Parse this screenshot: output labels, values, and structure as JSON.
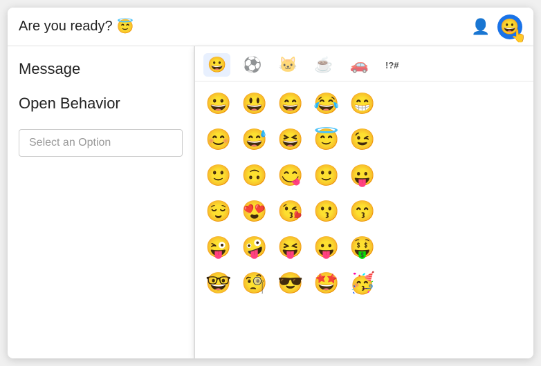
{
  "window": {
    "title": "Are you ready? 😇"
  },
  "header": {
    "title_text": "Are you ready?",
    "title_emoji": "😇",
    "person_icon": "👤",
    "emoji_icon": "😀"
  },
  "left_panel": {
    "field1_label": "Message",
    "field2_label": "Open Behavior",
    "select_placeholder": "Select an Option"
  },
  "emoji_picker": {
    "tabs": [
      {
        "id": "smileys",
        "icon": "😀",
        "active": true
      },
      {
        "id": "sports",
        "icon": "⚽",
        "active": false
      },
      {
        "id": "animals",
        "icon": "🐱",
        "active": false
      },
      {
        "id": "food",
        "icon": "☕",
        "active": false
      },
      {
        "id": "travel",
        "icon": "🚗",
        "active": false
      },
      {
        "id": "symbols",
        "icon": "⁉️",
        "active": false
      }
    ],
    "emoji_rows": [
      [
        "😀",
        "😃",
        "😄",
        "😂",
        "😁"
      ],
      [
        "😊",
        "😅",
        "😆",
        "😇",
        "😉"
      ],
      [
        "🙂",
        "🙃",
        "😋",
        "🙂",
        "😛"
      ],
      [
        "😌",
        "😍",
        "😘",
        "😗",
        "😙"
      ],
      [
        "😜",
        "🤪",
        "😝",
        "😛",
        "🤑"
      ],
      [
        "🤓",
        "🧐",
        "😎",
        "🤩",
        "🥳"
      ]
    ]
  }
}
